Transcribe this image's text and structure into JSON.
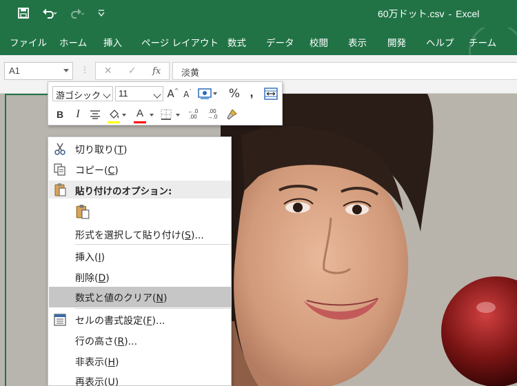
{
  "title_bar": {
    "document": "60万ドット.csv",
    "separator": "-",
    "app": "Excel"
  },
  "ribbon_tabs": [
    "ファイル",
    "ホーム",
    "挿入",
    "ページ レイアウト",
    "数式",
    "データ",
    "校閲",
    "表示",
    "開発",
    "ヘルプ",
    "チーム"
  ],
  "formula_bar": {
    "name_box": "A1",
    "cancel_icon": "✕",
    "enter_icon": "✓",
    "fx_label": "fx",
    "content": "淡黄"
  },
  "mini_toolbar": {
    "font_name": "游ゴシック",
    "font_size": "11",
    "grow_font": "A",
    "shrink_font": "A",
    "percent": "%",
    "comma": ",",
    "bold": "B",
    "italic": "I",
    "font_color_letter": "A",
    "increase_decimal": ".0\n.00",
    "decrease_decimal": ".00\n→.0",
    "fill_color": "#ffff00",
    "font_color": "#ff0000"
  },
  "context_menu": {
    "cut": {
      "text": "切り取り(",
      "key": "T",
      "end": ")"
    },
    "copy": {
      "text": "コピー(",
      "key": "C",
      "end": ")"
    },
    "paste_options": "貼り付けのオプション:",
    "paste_special": {
      "text": "形式を選択して貼り付け(",
      "key": "S",
      "end": ")..."
    },
    "insert": {
      "text": "挿入(",
      "key": "I",
      "end": ")"
    },
    "delete": {
      "text": "削除(",
      "key": "D",
      "end": ")"
    },
    "clear": {
      "text": "数式と値のクリア(",
      "key": "N",
      "end": ")"
    },
    "format_cells": {
      "text": "セルの書式設定(",
      "key": "F",
      "end": ")..."
    },
    "row_height": {
      "text": "行の高さ(",
      "key": "R",
      "end": ")..."
    },
    "hide": {
      "text": "非表示(",
      "key": "H",
      "end": ")"
    },
    "unhide": {
      "text": "再表示(",
      "key": "U",
      "end": ")"
    }
  }
}
